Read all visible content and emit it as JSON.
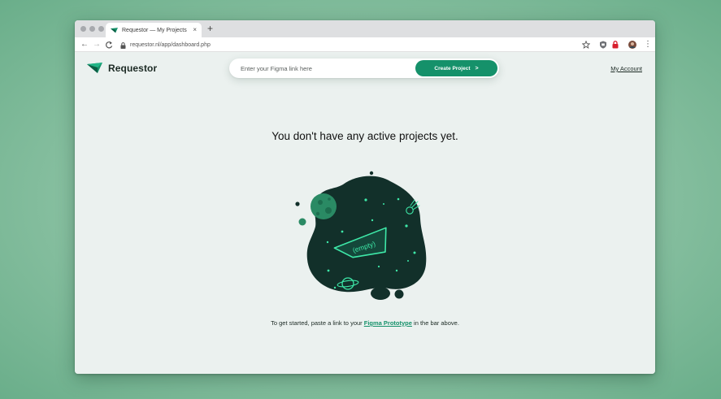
{
  "browser": {
    "tab_title": "Requestor — My Projects",
    "tab_close": "×",
    "new_tab": "+",
    "back": "←",
    "forward": "→",
    "reload": "C",
    "url": "requestor.nl/app/dashboard.php",
    "menu": "⋮"
  },
  "header": {
    "brand": "Requestor",
    "search_placeholder": "Enter your Figma link here",
    "create_label": "Create Project",
    "create_chevron": ">",
    "account_label": "My Account"
  },
  "main": {
    "headline": "You don't have any active projects yet.",
    "illustration_label": "(empty)",
    "help_prefix": "To get started, paste a link to your",
    "help_link": "Figma Prototype",
    "help_suffix": "in the bar above."
  },
  "colors": {
    "accent": "#15916a",
    "blob": "#12302a",
    "glow": "#3ee8a8",
    "page_bg": "#ebf1ef"
  }
}
